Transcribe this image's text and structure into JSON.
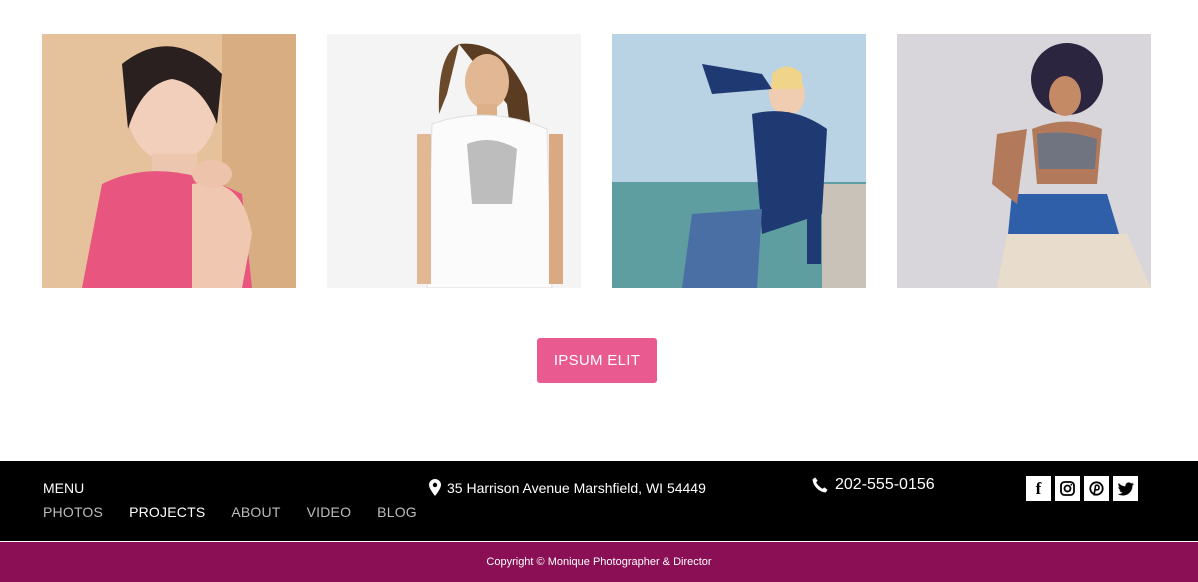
{
  "gallery": {
    "photos": [
      {
        "name": "model-pink-dress-photo"
      },
      {
        "name": "model-white-tshirt-photo"
      },
      {
        "name": "model-navy-blazer-photo"
      },
      {
        "name": "model-crop-top-photo"
      }
    ]
  },
  "cta": {
    "label": "IPSUM ELIT"
  },
  "footer": {
    "menu_title": "MENU",
    "nav": [
      {
        "label": "PHOTOS",
        "active": false
      },
      {
        "label": "PROJECTS",
        "active": true
      },
      {
        "label": "ABOUT",
        "active": false
      },
      {
        "label": "VIDEO",
        "active": false
      },
      {
        "label": "BLOG",
        "active": false
      }
    ],
    "address": "35 Harrison Avenue Marshfield, WI 54449",
    "phone": "202-555-0156",
    "socials": [
      "facebook-icon",
      "instagram-icon",
      "pinterest-icon",
      "twitter-icon"
    ]
  },
  "copyright": "Copyright © Monique Photographer & Director",
  "colors": {
    "accent": "#e95b90",
    "footer_bg": "#000000",
    "copyright_bg": "#8a0f55"
  }
}
